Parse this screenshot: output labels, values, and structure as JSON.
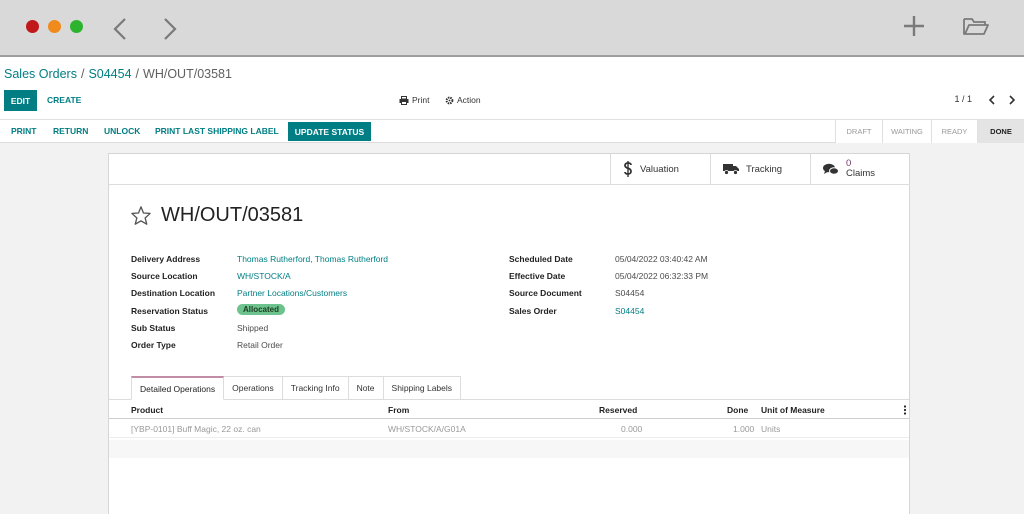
{
  "breadcrumb": {
    "items": [
      "Sales Orders",
      "S04454",
      "WH/OUT/03581"
    ],
    "separator": "/"
  },
  "control": {
    "edit": "EDIT",
    "create": "CREATE",
    "print": "Print",
    "action": "Action",
    "pager": "1 / 1"
  },
  "status_buttons": {
    "print": "PRINT",
    "return": "RETURN",
    "unlock": "UNLOCK",
    "print_label": "PRINT LAST SHIPPING LABEL",
    "update_status": "UPDATE STATUS"
  },
  "stages": [
    "DRAFT",
    "WAITING",
    "READY",
    "DONE"
  ],
  "smart_buttons": {
    "valuation": "Valuation",
    "tracking": "Tracking",
    "claims_count": "0",
    "claims": "Claims"
  },
  "record": {
    "title": "WH/OUT/03581"
  },
  "fields_left": [
    {
      "label": "Delivery Address",
      "value": "Thomas Rutherford, Thomas Rutherford"
    },
    {
      "label": "Source Location",
      "value": "WH/STOCK/A"
    },
    {
      "label": "Destination Location",
      "value": "Partner Locations/Customers"
    },
    {
      "label": "Reservation Status",
      "value": "Allocated"
    },
    {
      "label": "Sub Status",
      "value": "Shipped"
    },
    {
      "label": "Order Type",
      "value": "Retail Order"
    }
  ],
  "fields_right": [
    {
      "label": "Scheduled Date",
      "value": "05/04/2022 03:40:42 AM"
    },
    {
      "label": "Effective Date",
      "value": "05/04/2022 06:32:33 PM"
    },
    {
      "label": "Source Document",
      "value": "S04454"
    },
    {
      "label": "Sales Order",
      "value": "S04454"
    }
  ],
  "tabs": [
    "Detailed Operations",
    "Operations",
    "Tracking Info",
    "Note",
    "Shipping Labels"
  ],
  "table": {
    "headers": [
      "Product",
      "From",
      "Reserved",
      "Done",
      "Unit of Measure"
    ],
    "rows": [
      [
        "[YBP-0101] Buff Magic, 22 oz. can",
        "WH/STOCK/A/G01A",
        "0.000",
        "1.000",
        "Units"
      ]
    ]
  },
  "colors": {
    "primary": "#017e84",
    "badge": "#6cc38d",
    "active_tab": "#c08da4"
  }
}
